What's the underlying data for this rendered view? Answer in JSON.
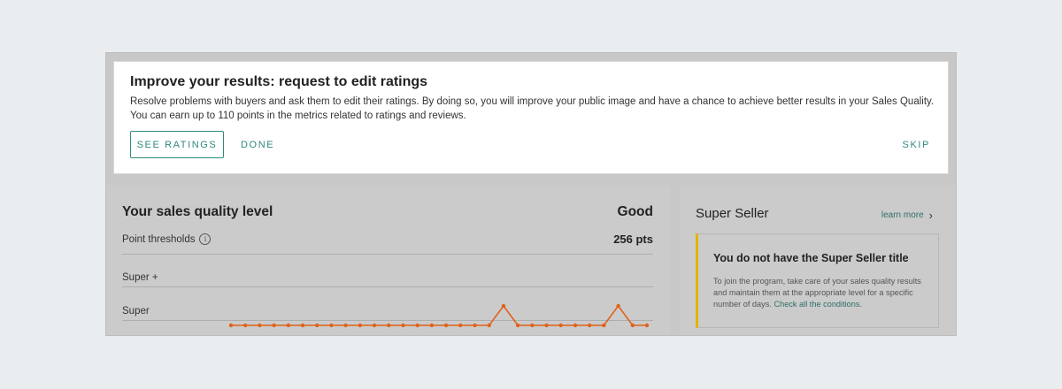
{
  "banner": {
    "title": "Improve your results: request to edit ratings",
    "description": "Resolve problems with buyers and ask them to edit their ratings. By doing so, you will improve your public image and have a chance to achieve better results in your Sales Quality. You can earn up to 110 points in the metrics related to ratings and reviews.",
    "see_ratings_label": "SEE RATINGS",
    "done_label": "DONE",
    "skip_label": "SKIP"
  },
  "sales_quality": {
    "title": "Your sales quality level",
    "level": "Good",
    "thresholds_label": "Point thresholds",
    "points": "256 pts",
    "levels": [
      "Super +",
      "Super"
    ]
  },
  "chart_data": {
    "type": "line",
    "series": [
      {
        "values": [
          0,
          0,
          0,
          0,
          0,
          0,
          0,
          0,
          0,
          0,
          0,
          0,
          0,
          0,
          0,
          0,
          0,
          0,
          0,
          1,
          0,
          0,
          0,
          0,
          0,
          0,
          0,
          1,
          0,
          0
        ]
      }
    ],
    "color": "#e0621a"
  },
  "super_seller": {
    "title": "Super Seller",
    "learn_more": "learn more",
    "box_title": "You do not have the Super Seller title",
    "box_text": "To join the program, take care of your sales quality results and maintain them at the appropriate level for a specific number of days.",
    "link_text": "Check all the conditions."
  },
  "colors": {
    "accent": "#2f8a7d",
    "warning": "#e0b400",
    "line": "#e0621a"
  }
}
